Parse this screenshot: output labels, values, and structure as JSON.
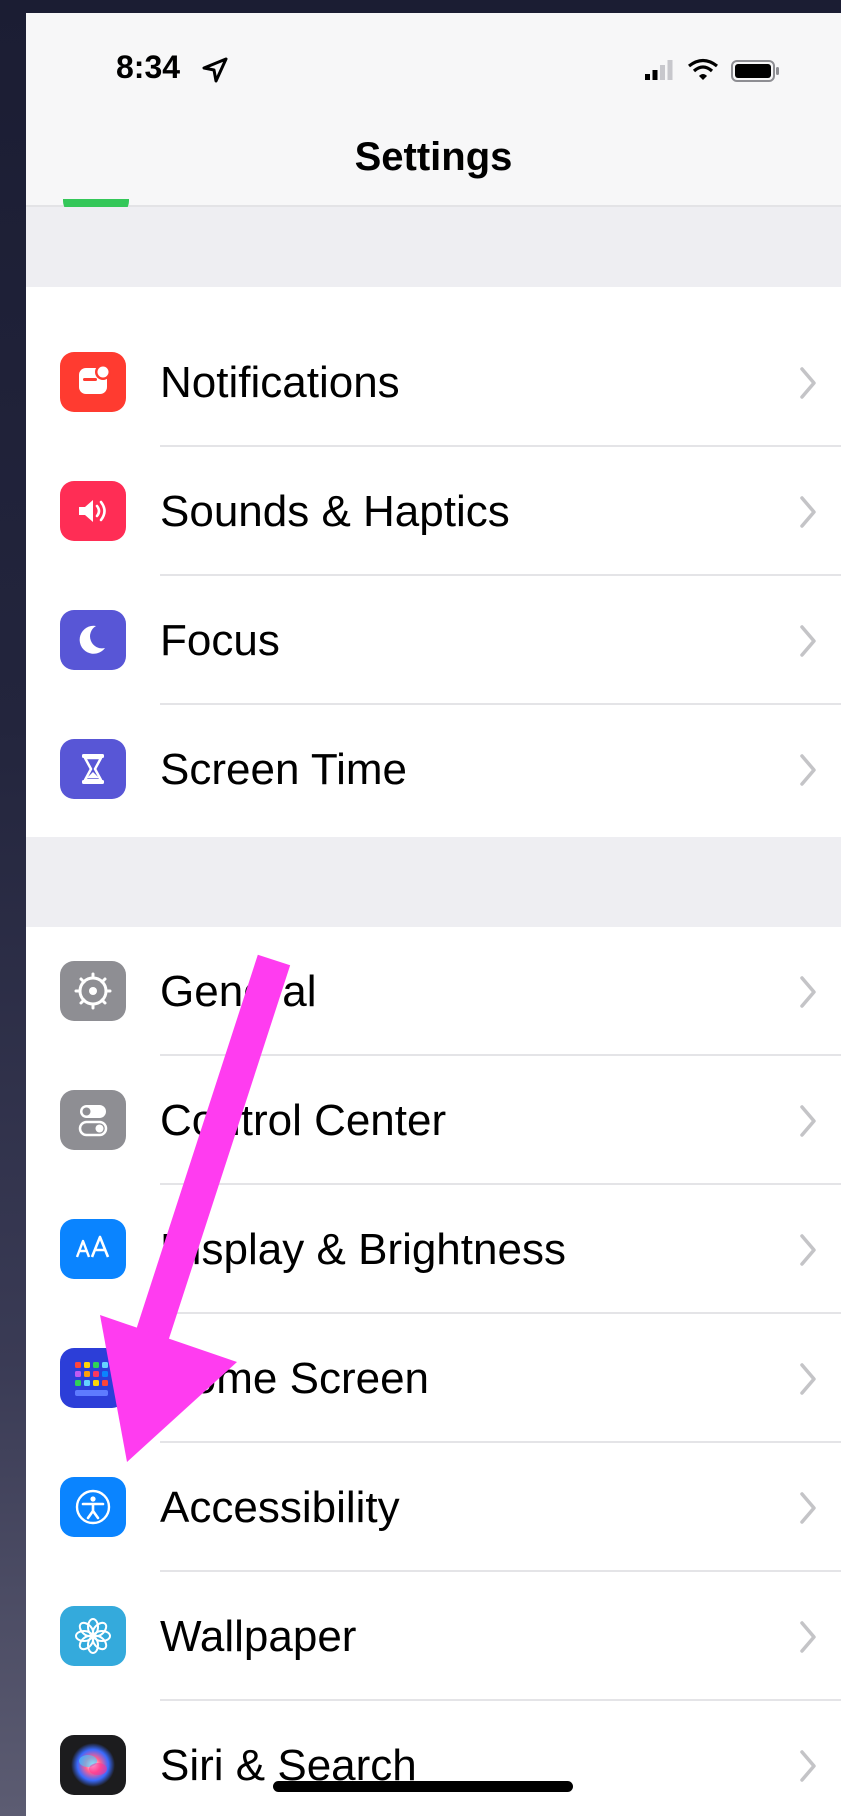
{
  "status_bar": {
    "time": "8:34"
  },
  "nav": {
    "title": "Settings"
  },
  "groups": [
    {
      "items": [
        {
          "key": "notifications",
          "label": "Notifications",
          "icon": "notifications-icon",
          "color": "#ff3b30"
        },
        {
          "key": "sounds",
          "label": "Sounds & Haptics",
          "icon": "speaker-icon",
          "color": "#ff2d55"
        },
        {
          "key": "focus",
          "label": "Focus",
          "icon": "moon-icon",
          "color": "#5856d6"
        },
        {
          "key": "screen-time",
          "label": "Screen Time",
          "icon": "hourglass-icon",
          "color": "#5856d6"
        }
      ]
    },
    {
      "items": [
        {
          "key": "general",
          "label": "General",
          "icon": "gear-icon",
          "color": "#8e8e93"
        },
        {
          "key": "control-center",
          "label": "Control Center",
          "icon": "toggles-icon",
          "color": "#8e8e93"
        },
        {
          "key": "display",
          "label": "Display & Brightness",
          "icon": "text-size-icon",
          "color": "#0a84ff"
        },
        {
          "key": "home-screen",
          "label": "Home Screen",
          "icon": "app-grid-icon",
          "color": "#2c3ed8"
        },
        {
          "key": "accessibility",
          "label": "Accessibility",
          "icon": "accessibility-icon",
          "color": "#0a84ff"
        },
        {
          "key": "wallpaper",
          "label": "Wallpaper",
          "icon": "flower-icon",
          "color": "#34aadc"
        },
        {
          "key": "siri",
          "label": "Siri & Search",
          "icon": "siri-icon",
          "color": "#1c1c1e"
        }
      ]
    }
  ],
  "annotation": {
    "arrow_color": "#ff3cf0",
    "points_to": "Accessibility"
  }
}
